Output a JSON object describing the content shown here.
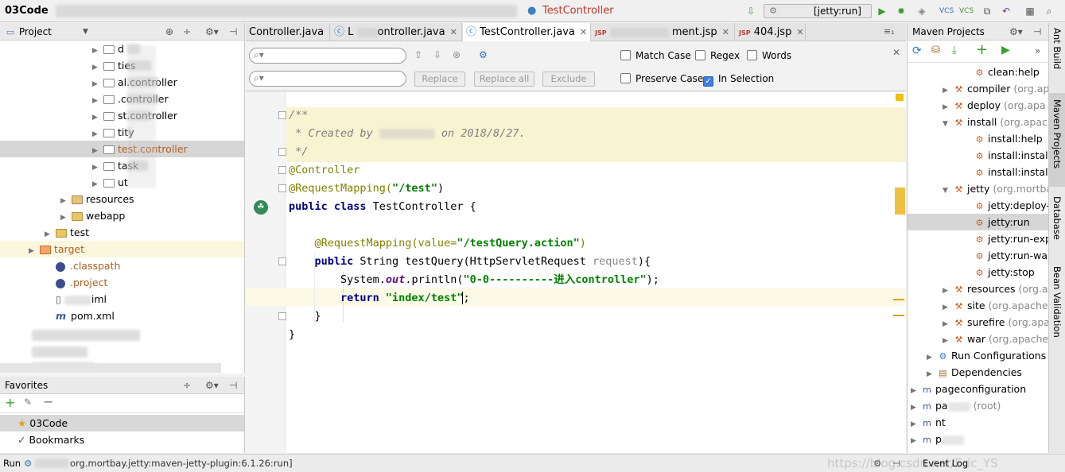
{
  "topbar": {
    "project_name": "03Code",
    "current_file": "TestController",
    "run_config": "[jetty:run]"
  },
  "project_panel": {
    "title": "Project",
    "items": [
      {
        "label": "d",
        "type": "package"
      },
      {
        "label": "ties",
        "type": "package"
      },
      {
        "label": "al.controller",
        "type": "package"
      },
      {
        "label": ".controller",
        "type": "package"
      },
      {
        "label": "st.controller",
        "type": "package"
      },
      {
        "label": "tity",
        "type": "package"
      },
      {
        "label": "test.controller",
        "type": "package",
        "selected": true
      },
      {
        "label": "task",
        "type": "package"
      },
      {
        "label": "ut",
        "type": "package"
      },
      {
        "label": "resources",
        "type": "resources"
      },
      {
        "label": "webapp",
        "type": "folder"
      },
      {
        "label": "test",
        "type": "folder"
      },
      {
        "label": "target",
        "type": "target"
      },
      {
        "label": ".classpath",
        "type": "file"
      },
      {
        "label": ".project",
        "type": "file"
      },
      {
        "label": "iml",
        "type": "file"
      },
      {
        "label": "pom.xml",
        "type": "maven"
      }
    ]
  },
  "favorites": {
    "title": "Favorites",
    "items": [
      {
        "label": "03Code",
        "icon": "star-icon"
      },
      {
        "label": "Bookmarks",
        "icon": "check-icon"
      }
    ]
  },
  "tabs": [
    {
      "label": "Controller.java",
      "active": false
    },
    {
      "label": "L",
      "label2": "ontroller.java",
      "active": false
    },
    {
      "label": "TestController.java",
      "active": true
    },
    {
      "label": "ment.jsp",
      "active": false
    },
    {
      "label": "404.jsp",
      "active": false
    }
  ],
  "tabs_overflow": "≡₁",
  "findbar": {
    "replace": "Replace",
    "replace_all": "Replace all",
    "exclude": "Exclude",
    "match_case": "Match Case",
    "regex": "Regex",
    "words": "Words",
    "preserve_case": "Preserve Case",
    "in_selection": "In Selection"
  },
  "code": {
    "l1": "/**",
    "l2a": " * Created by ",
    "l2b": " on 2018/8/27.",
    "l3": " */",
    "l4": "@Controller",
    "l5a": "@RequestMapping(",
    "l5b": "\"/test\"",
    "l5c": ")",
    "l6a": "public class ",
    "l6b": "TestController {",
    "l8a": "    @RequestMapping(value=",
    "l8b": "\"/testQuery.action\"",
    "l8c": ")",
    "l9a": "    public ",
    "l9b": "String testQuery(HttpServletRequest ",
    "l9c": "request",
    "l9d": "){",
    "l10a": "        System.",
    "l10b": "out",
    "l10c": ".println(",
    "l10d": "\"0-0----------进入controller\"",
    "l10e": ");",
    "l11a": "        return ",
    "l11b": "\"index/test\"",
    "l11c": ";",
    "l12": "    }",
    "l13": "}"
  },
  "maven": {
    "title": "Maven Projects",
    "items": [
      {
        "label": "clean:help",
        "type": "goal"
      },
      {
        "label": "compiler",
        "note": "(org.ap",
        "type": "plugin"
      },
      {
        "label": "deploy",
        "note": "(org.apa",
        "type": "plugin"
      },
      {
        "label": "install",
        "note": "(org.apach",
        "type": "plugin-open"
      },
      {
        "label": "install:help",
        "type": "goal"
      },
      {
        "label": "install:install",
        "type": "goal"
      },
      {
        "label": "install:install-f",
        "type": "goal"
      },
      {
        "label": "jetty",
        "note": "(org.mortba",
        "type": "plugin-open"
      },
      {
        "label": "jetty:deploy-w",
        "type": "goal"
      },
      {
        "label": "jetty:run",
        "type": "goal",
        "selected": true
      },
      {
        "label": "jetty:run-expl",
        "type": "goal"
      },
      {
        "label": "jetty:run-war",
        "type": "goal"
      },
      {
        "label": "jetty:stop",
        "type": "goal"
      },
      {
        "label": "resources",
        "note": "(org.a",
        "type": "plugin"
      },
      {
        "label": "site",
        "note": "(org.apache.",
        "type": "plugin"
      },
      {
        "label": "surefire",
        "note": "(org.apa",
        "type": "plugin"
      },
      {
        "label": "war",
        "note": "(org.apache",
        "type": "plugin"
      },
      {
        "label": "Run Configurations",
        "type": "config"
      },
      {
        "label": "Dependencies",
        "type": "deps"
      },
      {
        "label": "pageconfiguration",
        "type": "module"
      },
      {
        "label": "pa",
        "note": "(root)",
        "label2": "t",
        "type": "module"
      },
      {
        "label": "nt",
        "type": "module"
      },
      {
        "label": "p",
        "label2": "ssion",
        "type": "module"
      }
    ]
  },
  "side_strip": [
    "Ant Build",
    "Maven Projects",
    "Database",
    "Bean Validation"
  ],
  "status": {
    "run_label": "Run",
    "run_text": "org.mortbay.jetty:maven-jetty-plugin:6.1.26:run]",
    "watermark": "https://blog.csdn.net/Eric_YS",
    "event_log": "Event Log"
  },
  "colors": {
    "keyword": "#000080",
    "string": "#008000",
    "annotation": "#808000",
    "accent": "#3d7fe0"
  }
}
